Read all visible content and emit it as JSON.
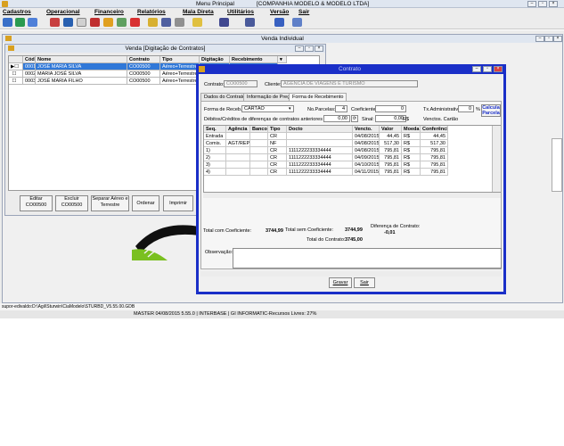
{
  "app": {
    "title": "Menu Principal",
    "company": "[COMPANHIA MODELO & MODELO LTDA]"
  },
  "menu": [
    "Cadastros",
    "Operacional",
    "Financeiro",
    "Relatórios",
    "Mala Direta",
    "Utilitários",
    "Versão",
    "Sair"
  ],
  "venda_individual": {
    "title": "Venda Individual"
  },
  "venda_grid": {
    "title": "Venda [Digitação de Contratos]",
    "headers": [
      "Cód",
      "Nome",
      "Contrato",
      "Tipo",
      "Digitação",
      "Recebimento"
    ],
    "rows": [
      [
        "0001",
        "JOSÉ MARIA SILVA",
        "CO00500",
        "Aéreo+Terrestre"
      ],
      [
        "0002",
        "MARIA JOSÉ SILVA",
        "CO00500",
        "Aéreo+Terrestre"
      ],
      [
        "0003",
        "JOSÉ MARIA FILHO",
        "CO00500",
        "Aéreo+Terrestre"
      ]
    ],
    "buttons": {
      "editar": "Editar CO00500",
      "excluir": "Excluir CO00500",
      "separar": "Separar Aéreo e Terrestre",
      "ordenar": "Ordenar",
      "imprimir": "Imprimir"
    }
  },
  "contrato": {
    "title": "Contrato",
    "contrato_label": "Contrato:",
    "contrato_value": "CO00500",
    "cliente_label": "Cliente:",
    "cliente_value": "AGENCIA DE VIAGENS E TURISMO",
    "tabs": [
      "Dados do Contrato",
      "Informação de Preços",
      "Forma de Recebimento"
    ],
    "forma_label": "Forma de Receb.:",
    "forma_value": "CARTÃO",
    "nparcelas_label": "No.Parcelas:",
    "nparcelas_value": "4",
    "coef_label": "Coeficiente:",
    "coef_value": "0",
    "txadm_label": "Tx.Administrativa:",
    "txadm_value": "0",
    "pct": "%",
    "calc_btn": "Calcula Parcela",
    "debitos_label": "Débitos/Créditos de diferenças de contratos anteriores (R$):",
    "debitos_value": "0,00",
    "sinal_label": "Sinal:",
    "sinal_value": "0,00",
    "sinal_unit": "R$",
    "venctos_label": "Venctos. Cartão",
    "grid_headers": [
      "Seq.",
      "Agência",
      "Banco",
      "Tipo",
      "Docto",
      "Vencto.",
      "Valor",
      "Moeda",
      "Conferência"
    ],
    "grid_rows": [
      [
        "Entrada",
        "",
        "",
        "CR",
        "",
        "04/08/2015",
        "44,45",
        "R$",
        "44,45"
      ],
      [
        "Comis.",
        "AGT/REP",
        "",
        "NF",
        "",
        "04/08/2015",
        "517,30",
        "R$",
        "517,30"
      ],
      [
        "1)",
        "",
        "",
        "CR",
        "1111222233334444",
        "04/08/2015",
        "795,81",
        "R$",
        "795,81"
      ],
      [
        "2)",
        "",
        "",
        "CR",
        "1111222233334444",
        "04/09/2015",
        "795,81",
        "R$",
        "795,81"
      ],
      [
        "3)",
        "",
        "",
        "CR",
        "1111222233334444",
        "04/10/2015",
        "795,81",
        "R$",
        "795,81"
      ],
      [
        "4)",
        "",
        "",
        "CR",
        "1111222233334444",
        "04/11/2015",
        "795,81",
        "R$",
        "795,81"
      ]
    ],
    "total_coef_label": "Total com Coeficiente:",
    "total_coef_value": "3744,99",
    "total_sem_label": "Total sem Coeficiente:",
    "total_sem_value": "3744,99",
    "total_contrato_label": "Total do Contrato:",
    "total_contrato_value": "3745,00",
    "diferenca_label": "Diferença de Contrato:",
    "diferenca_value": "-0,01",
    "obs_label": "Observação:",
    "gravar": "Gravar",
    "sair": "Sair"
  },
  "status": {
    "path": "supor-edivaldo:D:\\Agil\\Sturwin\\CiaModelo\\STURBD_V5.55.00.GDB",
    "bar": "MASTER        04/08/2015 5.55.0 | INTERBASE | GI INFORMATIC-Recursos Livres: 27%"
  },
  "colors": {
    "title_blue": "#1a2fc8",
    "selection": "#3078d8"
  }
}
